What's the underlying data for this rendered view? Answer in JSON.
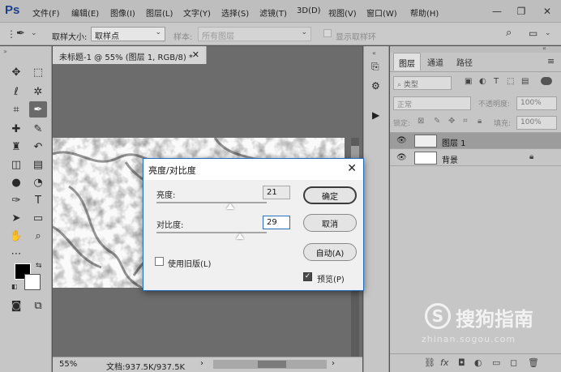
{
  "app": {
    "logo": "Ps"
  },
  "menu": [
    "文件(F)",
    "编辑(E)",
    "图像(I)",
    "图层(L)",
    "文字(Y)",
    "选择(S)",
    "滤镜(T)",
    "3D(D)",
    "视图(V)",
    "窗口(W)",
    "帮助(H)"
  ],
  "options": {
    "sample_size_label": "取样大小:",
    "sample_size_value": "取样点",
    "sample_label": "样本:",
    "sample_value": "所有图层",
    "show_ring_label": "显示取样环"
  },
  "document": {
    "tab_title": "未标题-1 @ 55% (图层 1, RGB/8) *",
    "zoom": "55%",
    "doc_size": "文档:937.5K/937.5K"
  },
  "panel": {
    "tabs": [
      "图层",
      "通道",
      "路径"
    ],
    "filter_kind": "类型",
    "blend_mode": "正常",
    "opacity_label": "不透明度:",
    "opacity_value": "100%",
    "lock_label": "锁定:",
    "fill_label": "填充:",
    "fill_value": "100%",
    "layers": [
      {
        "name": "图层 1",
        "selected": true
      },
      {
        "name": "背景",
        "selected": false
      }
    ]
  },
  "dialog": {
    "title": "亮度/对比度",
    "brightness_label": "亮度:",
    "brightness_value": "21",
    "contrast_label": "对比度:",
    "contrast_value": "29",
    "legacy_label": "使用旧版(L)",
    "legacy_checked": false,
    "preview_label": "预览(P)",
    "preview_checked": true,
    "ok_label": "确定",
    "cancel_label": "取消",
    "auto_label": "自动(A)"
  },
  "watermark": {
    "brand": "搜狗指南",
    "url": "zhinan.sogou.com"
  }
}
